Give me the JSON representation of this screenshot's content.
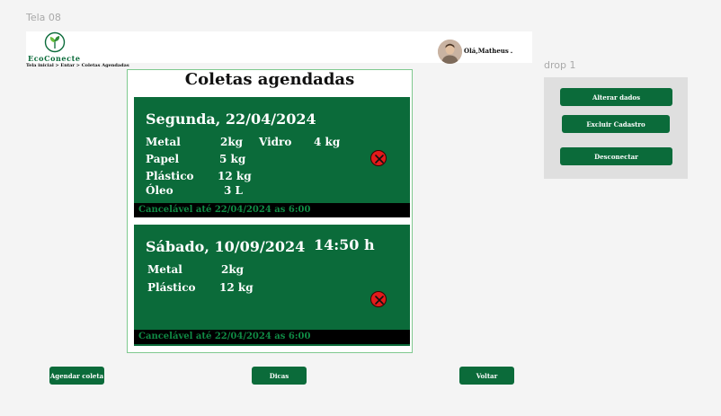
{
  "frame": {
    "label": "Tela 08",
    "dropdown_label": "drop 1"
  },
  "header": {
    "brand": "EcoConecte",
    "breadcrumb": "Tela inicial  > Entar >  Coletas Agendadas",
    "user_greeting": "Olá,Matheus"
  },
  "main": {
    "title": "Coletas agendadas",
    "cards": [
      {
        "date": "Segunda, 22/04/2024",
        "time": "",
        "items": [
          {
            "name": "Metal",
            "qty": "2kg"
          },
          {
            "name": "Vidro",
            "qty": "4 kg"
          },
          {
            "name": "Papel",
            "qty": "5 kg"
          },
          {
            "name": "Plástico",
            "qty": "12 kg"
          },
          {
            "name": "Óleo",
            "qty": "3 L"
          }
        ],
        "cancel_note": "Cancelável  até 22/04/2024 as 6:00"
      },
      {
        "date": "Sábado, 10/09/2024",
        "time": "14:50 h",
        "items": [
          {
            "name": "Metal",
            "qty": "2kg"
          },
          {
            "name": "Plástico",
            "qty": "12 kg"
          }
        ],
        "cancel_note": "Cancelável  até 22/04/2024 as 6:00"
      }
    ]
  },
  "footer": {
    "schedule_label": "Agendar coleta",
    "tips_label": "Dicas",
    "back_label": "Voltar"
  },
  "dropdown": {
    "items": [
      "Alterar dados",
      "Excluir Cadastro",
      "Desconectar"
    ]
  },
  "colors": {
    "brand_green": "#0b6b3a",
    "cancel_text_green": "#0f8a44",
    "cancel_icon_red": "#e21b1b"
  }
}
